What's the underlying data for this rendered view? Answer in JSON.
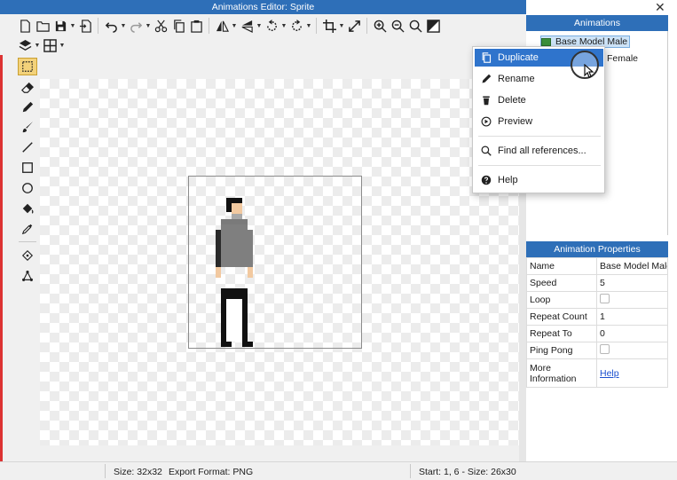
{
  "editor": {
    "title": "Animations Editor: Sprite",
    "toolbar_row1": [
      "new-file-icon",
      "open-folder-icon",
      "save-icon",
      "export-icon",
      "undo-icon",
      "redo-icon",
      "cut-icon",
      "copy-icon",
      "paste-icon",
      "flip-horizontal-icon",
      "flip-vertical-icon",
      "rotate-left-icon",
      "rotate-right-icon",
      "crop-icon",
      "resize-icon",
      "zoom-in-icon",
      "zoom-out-icon",
      "zoom-fit-icon",
      "toggle-background-icon"
    ],
    "toolbar_row2": [
      "layers-icon",
      "grid-icon"
    ],
    "tools": [
      "select-rectangle-icon",
      "eraser-icon",
      "pencil-icon",
      "brush-icon",
      "line-icon",
      "rectangle-icon",
      "ellipse-icon",
      "fill-bucket-icon",
      "color-picker-icon",
      "origin-icon",
      "mask-icon"
    ]
  },
  "status": {
    "size": "Size: 32x32",
    "export_format": "Export Format: PNG",
    "selection": "Start: 1, 6 - Size: 26x30"
  },
  "animations_panel": {
    "title": "Animations",
    "items": [
      {
        "label": "Base Model Male",
        "selected": true
      },
      {
        "label": "Female"
      }
    ]
  },
  "context_menu": {
    "items": [
      {
        "label": "Duplicate",
        "icon": "duplicate-icon",
        "highlighted": true
      },
      {
        "label": "Rename",
        "icon": "rename-icon"
      },
      {
        "label": "Delete",
        "icon": "trash-icon"
      },
      {
        "label": "Preview",
        "icon": "play-icon"
      },
      {
        "label": "Find all references...",
        "icon": "search-icon"
      },
      {
        "label": "Help",
        "icon": "help-icon"
      }
    ]
  },
  "properties_panel": {
    "title": "Animation Properties",
    "rows": [
      {
        "key": "Name",
        "value": "Base Model Male"
      },
      {
        "key": "Speed",
        "value": "5"
      },
      {
        "key": "Loop",
        "value": ""
      },
      {
        "key": "Repeat Count",
        "value": "1"
      },
      {
        "key": "Repeat To",
        "value": "0"
      },
      {
        "key": "Ping Pong",
        "value": ""
      },
      {
        "key": "More Information",
        "value": "Help"
      }
    ]
  },
  "colors": {
    "title_bar": "#2e6fb8",
    "menu_highlight": "#2f74cc",
    "tool_active": "#f3d27a",
    "link": "#1a4fcf"
  }
}
